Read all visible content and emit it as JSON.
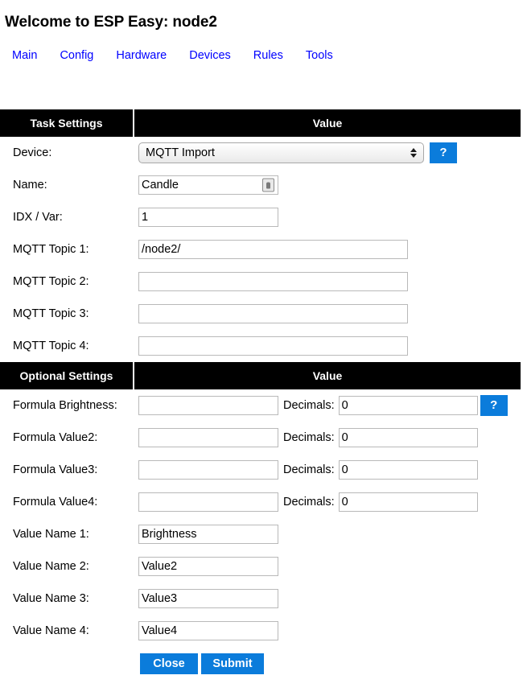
{
  "page": {
    "title": "Welcome to ESP Easy: node2"
  },
  "nav": {
    "items": [
      {
        "label": "Main"
      },
      {
        "label": "Config"
      },
      {
        "label": "Hardware"
      },
      {
        "label": "Devices"
      },
      {
        "label": "Rules"
      },
      {
        "label": "Tools"
      }
    ]
  },
  "task_settings": {
    "header_left": "Task Settings",
    "header_right": "Value",
    "device": {
      "label": "Device:",
      "selected": "MQTT Import",
      "options": [
        "MQTT Import"
      ],
      "help_label": "?"
    },
    "name": {
      "label": "Name:",
      "value": "Candle",
      "autofill_icon": "contact-card-icon"
    },
    "idx": {
      "label": "IDX / Var:",
      "value": "1"
    },
    "topics": [
      {
        "label": "MQTT Topic 1:",
        "value": "/node2/"
      },
      {
        "label": "MQTT Topic 2:",
        "value": ""
      },
      {
        "label": "MQTT Topic 3:",
        "value": ""
      },
      {
        "label": "MQTT Topic 4:",
        "value": ""
      }
    ]
  },
  "optional_settings": {
    "header_left": "Optional Settings",
    "header_right": "Value",
    "decimals_label": "Decimals:",
    "help_label": "?",
    "formulas": [
      {
        "label": "Formula Brightness:",
        "formula": "",
        "decimals": "0"
      },
      {
        "label": "Formula Value2:",
        "formula": "",
        "decimals": "0"
      },
      {
        "label": "Formula Value3:",
        "formula": "",
        "decimals": "0"
      },
      {
        "label": "Formula Value4:",
        "formula": "",
        "decimals": "0"
      }
    ],
    "value_names": [
      {
        "label": "Value Name 1:",
        "value": "Brightness"
      },
      {
        "label": "Value Name 2:",
        "value": "Value2"
      },
      {
        "label": "Value Name 3:",
        "value": "Value3"
      },
      {
        "label": "Value Name 4:",
        "value": "Value4"
      }
    ]
  },
  "actions": {
    "close_label": "Close",
    "submit_label": "Submit"
  },
  "colors": {
    "accent_blue": "#0b7cdb",
    "link_blue": "#0000ff",
    "header_bar": "#000000"
  }
}
